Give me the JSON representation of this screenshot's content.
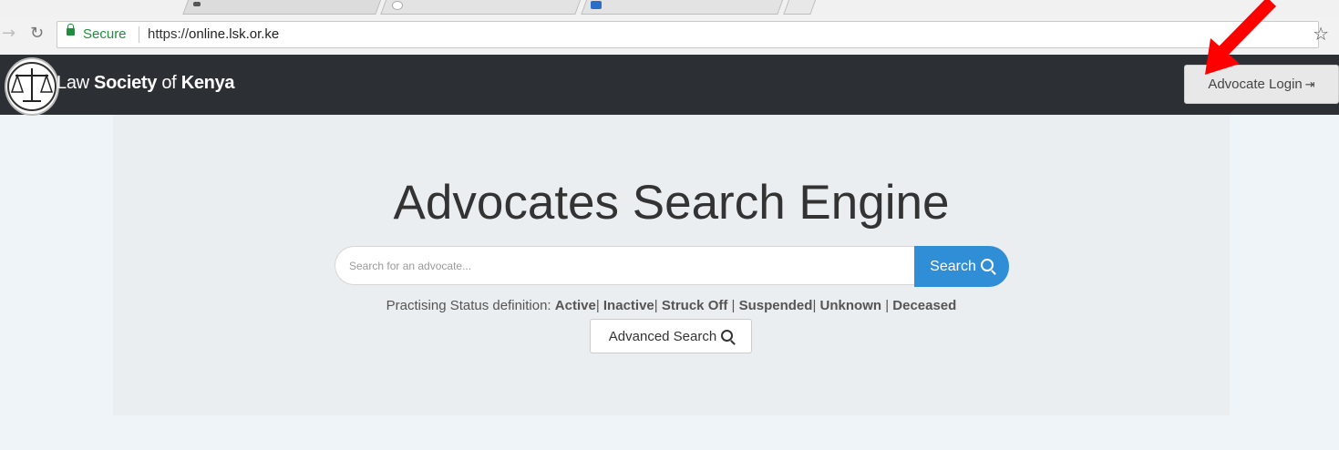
{
  "browser": {
    "secure_label": "Secure",
    "url_scheme": "https://",
    "url_host": "online.lsk.or.ke",
    "icons": [
      "forward-icon",
      "reload-icon",
      "lock-icon",
      "star-icon"
    ]
  },
  "navbar": {
    "brand_word1": "Law ",
    "brand_word2": "Society",
    "brand_word3": " of ",
    "brand_word4": "Kenya",
    "login_label": "Advocate Login",
    "colors": {
      "background": "#2c2f34",
      "login_bg": "#e8e8e8"
    }
  },
  "main": {
    "title": "Advocates Search Engine",
    "search_placeholder": "Search for an advocate...",
    "search_label": "Search",
    "status_prefix": "Practising Status definition:",
    "statuses": [
      "Active",
      "Inactive",
      "Struck Off",
      "Suspended",
      "Unknown",
      "Deceased"
    ],
    "advanced_label": "Advanced Search",
    "colors": {
      "search_button": "#2f8ed6",
      "jumbotron": "#ebeef0",
      "page": "#eef4f7"
    }
  },
  "annotation": {
    "arrow_color": "#ff0000"
  }
}
